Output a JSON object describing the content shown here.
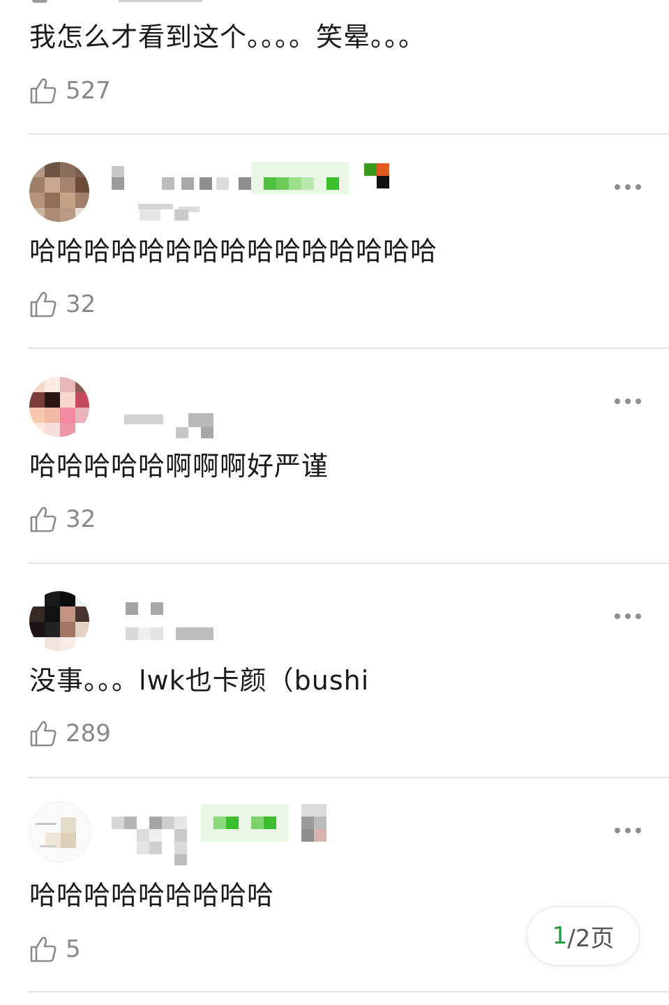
{
  "comments": [
    {
      "text": "我怎么才看到这个。。。。笑晕。。。",
      "likes": "527"
    },
    {
      "text": "哈哈哈哈哈哈哈哈哈哈哈哈哈哈哈",
      "likes": "32"
    },
    {
      "text": "哈哈哈哈哈啊啊啊好严谨",
      "likes": "32"
    },
    {
      "text": "没事。。。lwk也卡颜（bushi",
      "likes": "289"
    },
    {
      "text": "哈哈哈哈哈哈哈哈哈",
      "likes": "5"
    }
  ],
  "pager": {
    "current": "1",
    "total_label": "/2页"
  },
  "icons": {
    "like": "thumbs-up-icon",
    "more": "more-dots-icon"
  },
  "colors": {
    "accent": "#1e9b3b",
    "muted": "#888888",
    "divider": "#e3e3e3"
  }
}
